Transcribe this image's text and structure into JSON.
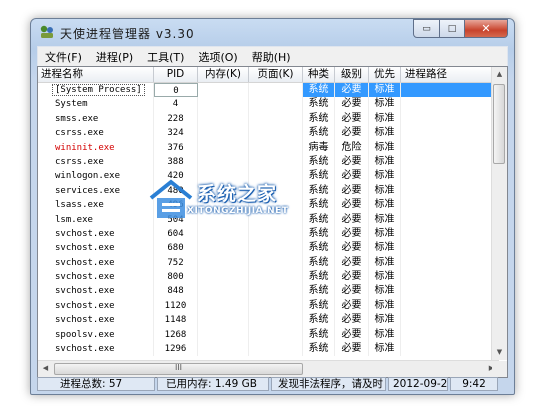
{
  "window": {
    "title": "天使进程管理器 v3.30",
    "close_glyph": "✕",
    "min_glyph": "▭",
    "max_glyph": "□"
  },
  "menu": [
    {
      "label": "文件(F)"
    },
    {
      "label": "进程(P)"
    },
    {
      "label": "工具(T)"
    },
    {
      "label": "选项(O)"
    },
    {
      "label": "帮助(H)"
    }
  ],
  "columns": {
    "name": "进程名称",
    "pid": "PID",
    "mem": "内存(K)",
    "page": "页面(K)",
    "kind": "种类",
    "level": "级别",
    "prio": "优先",
    "path": "进程路径"
  },
  "rows": [
    {
      "name": "[System Process]",
      "pid": "0",
      "kind": "系统",
      "level": "必要",
      "prio": "标准",
      "selected": true
    },
    {
      "name": "System",
      "pid": "4",
      "kind": "系统",
      "level": "必要",
      "prio": "标准"
    },
    {
      "name": "smss.exe",
      "pid": "228",
      "kind": "系统",
      "level": "必要",
      "prio": "标准"
    },
    {
      "name": "csrss.exe",
      "pid": "324",
      "kind": "系统",
      "level": "必要",
      "prio": "标准"
    },
    {
      "name": "wininit.exe",
      "pid": "376",
      "kind": "病毒",
      "level": "危险",
      "prio": "标准",
      "danger": true
    },
    {
      "name": "csrss.exe",
      "pid": "388",
      "kind": "系统",
      "level": "必要",
      "prio": "标准"
    },
    {
      "name": "winlogon.exe",
      "pid": "420",
      "kind": "系统",
      "level": "必要",
      "prio": "标准"
    },
    {
      "name": "services.exe",
      "pid": "480",
      "kind": "系统",
      "level": "必要",
      "prio": "标准"
    },
    {
      "name": "lsass.exe",
      "pid": "496",
      "kind": "系统",
      "level": "必要",
      "prio": "标准"
    },
    {
      "name": "lsm.exe",
      "pid": "504",
      "kind": "系统",
      "level": "必要",
      "prio": "标准"
    },
    {
      "name": "svchost.exe",
      "pid": "604",
      "kind": "系统",
      "level": "必要",
      "prio": "标准"
    },
    {
      "name": "svchost.exe",
      "pid": "680",
      "kind": "系统",
      "level": "必要",
      "prio": "标准"
    },
    {
      "name": "svchost.exe",
      "pid": "752",
      "kind": "系统",
      "level": "必要",
      "prio": "标准"
    },
    {
      "name": "svchost.exe",
      "pid": "800",
      "kind": "系统",
      "level": "必要",
      "prio": "标准"
    },
    {
      "name": "svchost.exe",
      "pid": "848",
      "kind": "系统",
      "level": "必要",
      "prio": "标准"
    },
    {
      "name": "svchost.exe",
      "pid": "1120",
      "kind": "系统",
      "level": "必要",
      "prio": "标准"
    },
    {
      "name": "svchost.exe",
      "pid": "1148",
      "kind": "系统",
      "level": "必要",
      "prio": "标准"
    },
    {
      "name": "spoolsv.exe",
      "pid": "1268",
      "kind": "系统",
      "level": "必要",
      "prio": "标准"
    },
    {
      "name": "svchost.exe",
      "pid": "1296",
      "kind": "系统",
      "level": "必要",
      "prio": "标准"
    }
  ],
  "scroll": {
    "up": "▲",
    "down": "▼",
    "left": "◀",
    "right": "▶",
    "grip": "III"
  },
  "status": {
    "count": "进程总数: 57",
    "memory": "已用内存: 1.49 GB",
    "message": "发现非法程序，请及时",
    "date": "2012-09-29",
    "time": "9:42"
  },
  "watermark": {
    "text": "系统之家",
    "sub": "XITONGZHIJIA.NET"
  },
  "colors": {
    "selection": "#3399ff",
    "danger": "#d40000",
    "close": "#c8432c"
  }
}
